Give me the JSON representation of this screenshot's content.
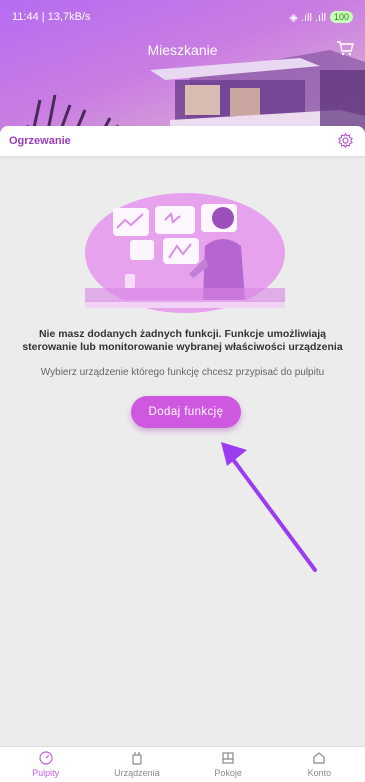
{
  "status": {
    "time_speed": "11:44 | 13,7kB/s",
    "signal": "◈ .ıll .ıll",
    "battery": "100"
  },
  "header": {
    "title": "Mieszkanie"
  },
  "section": {
    "title": "Ogrzewanie"
  },
  "empty_state": {
    "message": "Nie masz dodanych żadnych funkcji. Funkcje umożliwiają sterowanie lub monitorowanie wybranej właściwości urządzenia",
    "hint": "Wybierz urządzenie którego funkcję chcesz przypisać do pulpitu",
    "button_label": "Dodaj funkcję"
  },
  "nav": {
    "items": [
      {
        "label": "Pulpity",
        "icon": "dashboard-icon",
        "active": true
      },
      {
        "label": "Urządzenia",
        "icon": "device-icon",
        "active": false
      },
      {
        "label": "Pokoje",
        "icon": "rooms-icon",
        "active": false
      },
      {
        "label": "Konto",
        "icon": "account-icon",
        "active": false
      }
    ]
  },
  "colors": {
    "accent": "#c260e0",
    "button": "#cf58e0",
    "arrow": "#9b3cf0"
  }
}
